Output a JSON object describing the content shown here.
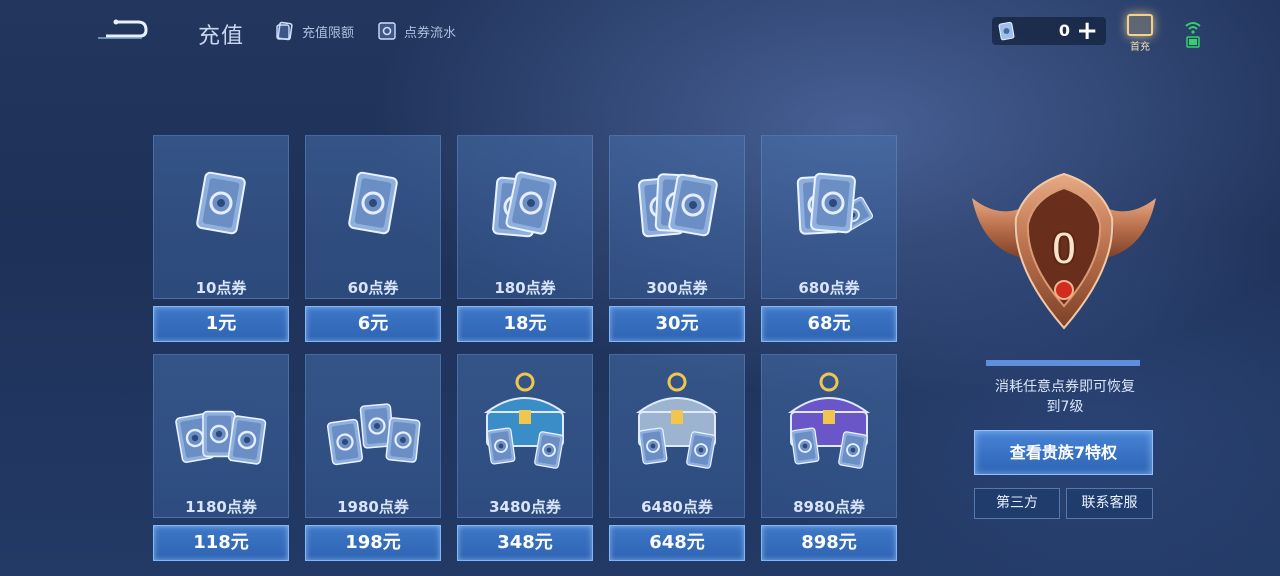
{
  "header": {
    "title": "充值",
    "links": [
      {
        "label": "充值限额",
        "icon": "card-limit-icon"
      },
      {
        "label": "点券流水",
        "icon": "card-flow-icon"
      }
    ],
    "currency": {
      "amount": "0",
      "plus": "+",
      "icon": "voucher-icon"
    },
    "first_charge": {
      "label": "首充",
      "icon": "gift-box-icon"
    },
    "status_icons": [
      "wifi-icon",
      "battery-icon"
    ]
  },
  "products": [
    {
      "qty": "10点券",
      "price": "1元",
      "art": "voucher-single"
    },
    {
      "qty": "60点券",
      "price": "6元",
      "art": "voucher-single"
    },
    {
      "qty": "180点券",
      "price": "18元",
      "art": "voucher-double"
    },
    {
      "qty": "300点券",
      "price": "30元",
      "art": "voucher-triple"
    },
    {
      "qty": "680点券",
      "price": "68元",
      "art": "voucher-fan"
    },
    {
      "qty": "1180点券",
      "price": "118元",
      "art": "voucher-stack"
    },
    {
      "qty": "1980点券",
      "price": "198元",
      "art": "voucher-pile"
    },
    {
      "qty": "3480点券",
      "price": "348元",
      "art": "chest-blue"
    },
    {
      "qty": "6480点券",
      "price": "648元",
      "art": "chest-silver"
    },
    {
      "qty": "8980点券",
      "price": "898元",
      "art": "chest-purple"
    }
  ],
  "vip": {
    "level": "0",
    "progress": 1.0,
    "restore_text_line1": "消耗任意点券即可恢复",
    "restore_text_line2": "到7级",
    "privilege_button": "查看贵族7特权",
    "third_party_button": "第三方",
    "support_button": "联系客服"
  },
  "colors": {
    "accent": "#3e78c8",
    "badge": "#c27a55",
    "firstcharge": "#f4d28a"
  }
}
